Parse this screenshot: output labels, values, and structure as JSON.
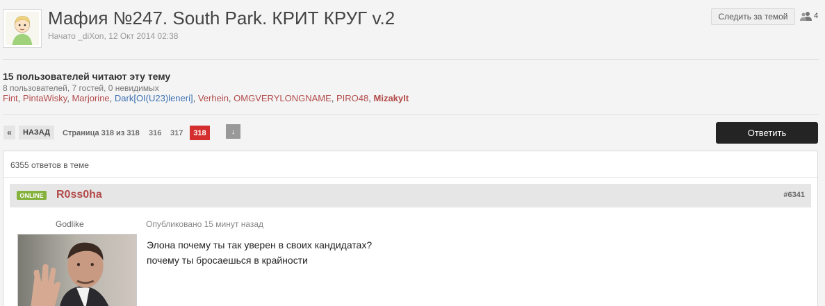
{
  "topic": {
    "title": "Мафия №247. South Park. КРИТ КРУГ v.2",
    "meta": "Начато _diXon, 12 Окт 2014 02:38",
    "follow_label": "Следить за темой",
    "followers_count": "4"
  },
  "readers": {
    "title": "15 пользователей читают эту тему",
    "counts": "8 пользователей, 7 гостей, 0 невидимых",
    "users": [
      {
        "name": "Fint",
        "color": "#b34a4a"
      },
      {
        "name": "PintaWisky",
        "color": "#b34a4a"
      },
      {
        "name": "Marjorine",
        "color": "#b34a4a"
      },
      {
        "name": "Dark[OI(U23)leneri]",
        "color": "#3d70b2"
      },
      {
        "name": "Verhein",
        "color": "#b34a4a"
      },
      {
        "name": "OMGVERYLONGNAME",
        "color": "#b34a4a"
      },
      {
        "name": "PIRO48",
        "color": "#b34a4a"
      },
      {
        "name": "MizakyIt",
        "color": "#b34a4a",
        "bold": true
      }
    ]
  },
  "pagination": {
    "prev": "«",
    "back": "НАЗАД",
    "info": "Страница 318 из 318",
    "pages": [
      "316",
      "317"
    ],
    "current": "318",
    "jump": "↓"
  },
  "reply_label": "Ответить",
  "posts": {
    "count_text": "6355 ответов в теме",
    "post": {
      "online": "ONLINE",
      "author": "R0ss0ha",
      "number": "#6341",
      "rank": "Godlike",
      "published": "Опубликовано 15 минут назад",
      "lines": [
        "Элона почему ты так уверен в своих кандидатах?",
        "почему ты бросаешься в крайности"
      ]
    }
  },
  "colors": {
    "accent_red": "#d42e2e",
    "username": "#b34a4a",
    "online_green": "#84b23d",
    "button_dark": "#242424"
  }
}
